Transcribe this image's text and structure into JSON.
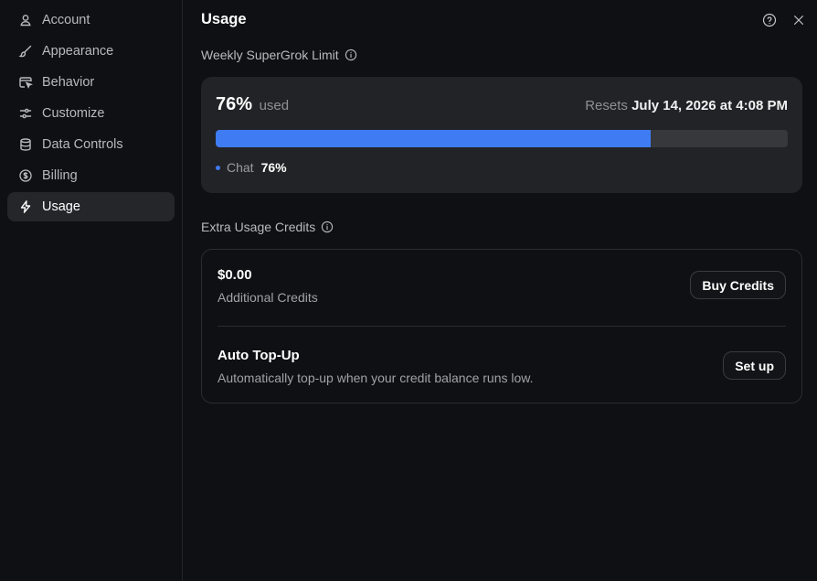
{
  "sidebar": {
    "items": [
      {
        "label": "Account",
        "icon": "user-icon"
      },
      {
        "label": "Appearance",
        "icon": "brush-icon"
      },
      {
        "label": "Behavior",
        "icon": "window-cursor-icon"
      },
      {
        "label": "Customize",
        "icon": "sliders-icon"
      },
      {
        "label": "Data Controls",
        "icon": "database-icon"
      },
      {
        "label": "Billing",
        "icon": "dollar-circle-icon"
      },
      {
        "label": "Usage",
        "icon": "lightning-icon",
        "active": true
      }
    ]
  },
  "main": {
    "title": "Usage",
    "weekly": {
      "label": "Weekly SuperGrok Limit",
      "percent_text": "76%",
      "percent_suffix": "used",
      "progress_fraction": 0.76,
      "resets_prefix": "Resets",
      "resets_date": "July 14, 2026 at 4:08 PM",
      "legend_label": "Chat",
      "legend_value": "76%"
    },
    "extra": {
      "label": "Extra Usage Credits",
      "credits_amount": "$0.00",
      "credits_sub": "Additional Credits",
      "buy_button": "Buy Credits",
      "auto_title": "Auto Top-Up",
      "auto_sub": "Automatically top-up when your credit balance runs low.",
      "setup_button": "Set up"
    }
  },
  "colors": {
    "accent": "#3f7cf4",
    "background": "#0f1013",
    "card": "#222326"
  }
}
